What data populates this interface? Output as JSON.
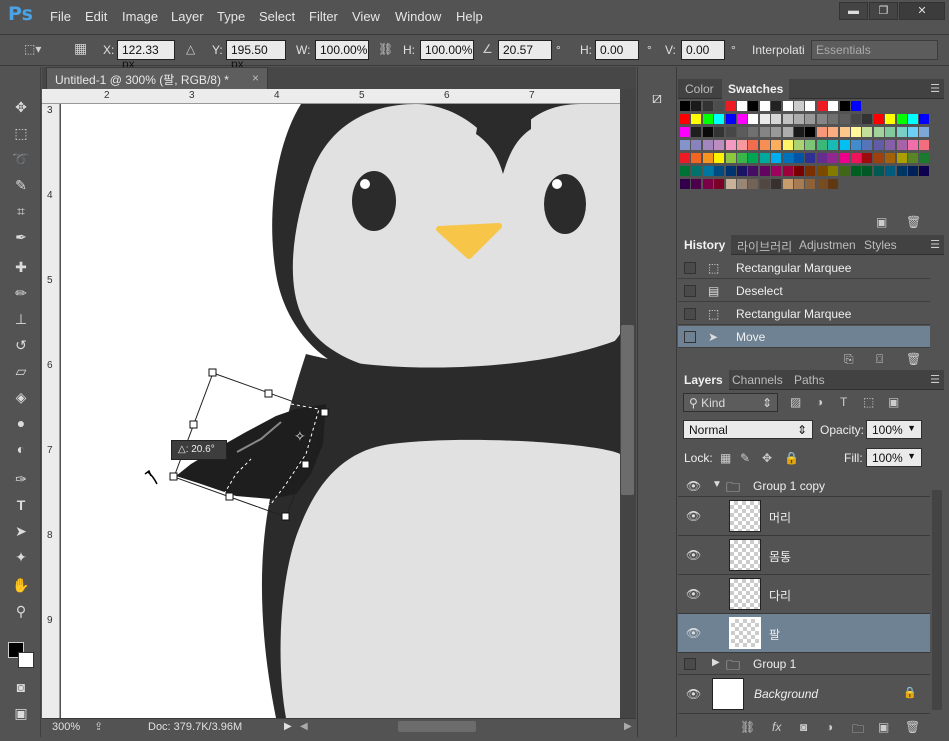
{
  "app": {
    "logo": "Ps"
  },
  "menu": [
    "File",
    "Edit",
    "Image",
    "Layer",
    "Type",
    "Select",
    "Filter",
    "View",
    "Window",
    "Help"
  ],
  "window_controls": {
    "minimize": "▬",
    "restore": "❐",
    "close": "✕"
  },
  "options_bar": {
    "x_label": "X:",
    "x_value": "122.33 px",
    "y_label": "Y:",
    "y_value": "195.50 px",
    "w_label": "W:",
    "w_value": "100.00%",
    "h_label": "H:",
    "h_value": "100.00%",
    "angle_value": "20.57",
    "angle_unit": "°",
    "hskew_label": "H:",
    "hskew_value": "0.00",
    "hskew_unit": "°",
    "vskew_label": "V:",
    "vskew_value": "0.00",
    "vskew_unit": "°",
    "interp_label": "Interpolati",
    "workspace": "Essentials"
  },
  "document": {
    "tab_title": "Untitled-1 @ 300% (팔, RGB/8) *",
    "ruler_top": [
      "2",
      "3",
      "4",
      "5",
      "6",
      "7"
    ],
    "ruler_left": [
      "3",
      "4",
      "5",
      "6",
      "7",
      "8",
      "9"
    ],
    "transform_tooltip": "△: 20.6°",
    "zoom": "300%",
    "doc_info": "Doc: 379.7K/3.96M"
  },
  "swatches_panel": {
    "tabs": [
      "Color",
      "Swatches"
    ],
    "rows": [
      [
        "#000000",
        "#1a1a1a",
        "#333333",
        "#4d4d4d",
        "#ed1c24",
        "#ffffff",
        "#000000",
        "#ffffff",
        "#222222",
        "#ffffff",
        "#cccccc",
        "#ffffff",
        "#ed1c24",
        "#ffffff",
        "#000000",
        "#0000ff"
      ],
      [
        "#ff0000",
        "#ffff00",
        "#00ff00",
        "#00ffff",
        "#0000ff",
        "#ff00ff",
        "#ffffff",
        "#ebebeb",
        "#d6d6d6",
        "#c2c2c2",
        "#adadad",
        "#999999",
        "#858585",
        "#707070",
        "#5c5c5c",
        "#474747",
        "#333333",
        "#ff0000",
        "#ffff00",
        "#00ff00",
        "#00ffff",
        "#0000ff"
      ],
      [
        "#ff00ff",
        "#1f1f1f",
        "#0a0a0a",
        "#333333",
        "#474747",
        "#5c5c5c",
        "#707070",
        "#858585",
        "#999999",
        "#adadad",
        "#1a1a1a",
        "#000000",
        "#f7977a",
        "#f9ad81",
        "#fdc68a",
        "#fff79a",
        "#c4df9b",
        "#a2d39c",
        "#82ca9d",
        "#7bcdc8",
        "#6ecff6",
        "#7ea7d8"
      ],
      [
        "#8493ca",
        "#8882be",
        "#a187be",
        "#bc8dbf",
        "#f49ac2",
        "#f6989d",
        "#f26c4f",
        "#f68e55",
        "#fbaf5c",
        "#fff467",
        "#acd372",
        "#7cc576",
        "#3bb878",
        "#1abbb4",
        "#00bff3",
        "#438ccb",
        "#5574b9",
        "#605ca8",
        "#855fa8",
        "#a763a8",
        "#f06eaa",
        "#f26d7d"
      ],
      [
        "#ed1c24",
        "#f26522",
        "#f7941d",
        "#fff200",
        "#8dc73f",
        "#39b54a",
        "#00a651",
        "#00a99d",
        "#00aeef",
        "#0072bc",
        "#0054a6",
        "#2e3192",
        "#662d91",
        "#92278f",
        "#ec008c",
        "#ed145b",
        "#9e0b0f",
        "#a0410d",
        "#a36209",
        "#aba000",
        "#598527",
        "#1a7b30"
      ],
      [
        "#007236",
        "#00746b",
        "#0076a3",
        "#004b80",
        "#003471",
        "#1b1464",
        "#440e62",
        "#630460",
        "#9e005d",
        "#9e0039",
        "#790000",
        "#7b2e00",
        "#7d4900",
        "#827b00",
        "#406618",
        "#005e20",
        "#005826",
        "#005952",
        "#005b7f",
        "#003663",
        "#002157",
        "#0d004c"
      ],
      [
        "#32004b",
        "#4b0049",
        "#7b0046",
        "#7a0026",
        "#c7b299",
        "#998675",
        "#736357",
        "#534741",
        "#37302d",
        "#c69c6d",
        "#a67c52",
        "#8c6239",
        "#754c24",
        "#603913"
      ]
    ]
  },
  "history_panel": {
    "tabs": [
      "History",
      "라이브러리",
      "Adjustmen",
      "Styles"
    ],
    "items": [
      {
        "label": "Rectangular Marquee",
        "icon": "marquee-icon"
      },
      {
        "label": "Deselect",
        "icon": "document-icon"
      },
      {
        "label": "Rectangular Marquee",
        "icon": "marquee-icon"
      },
      {
        "label": "Move",
        "icon": "move-icon",
        "selected": true
      }
    ]
  },
  "layers_panel": {
    "tabs": [
      "Layers",
      "Channels",
      "Paths"
    ],
    "filter": "Kind",
    "blend_mode": "Normal",
    "opacity_label": "Opacity:",
    "opacity": "100%",
    "lock_label": "Lock:",
    "fill_label": "Fill:",
    "fill": "100%",
    "layers": [
      {
        "name": "Group 1 copy",
        "type": "group",
        "expanded": true,
        "visible": true
      },
      {
        "name": "머리",
        "type": "layer",
        "visible": true
      },
      {
        "name": "몸통",
        "type": "layer",
        "visible": true
      },
      {
        "name": "다리",
        "type": "layer",
        "visible": true
      },
      {
        "name": "팔",
        "type": "layer",
        "visible": true,
        "selected": true
      },
      {
        "name": "Group 1",
        "type": "group",
        "expanded": false,
        "visible": false
      },
      {
        "name": "Background",
        "type": "background",
        "visible": true,
        "locked": true
      }
    ]
  }
}
